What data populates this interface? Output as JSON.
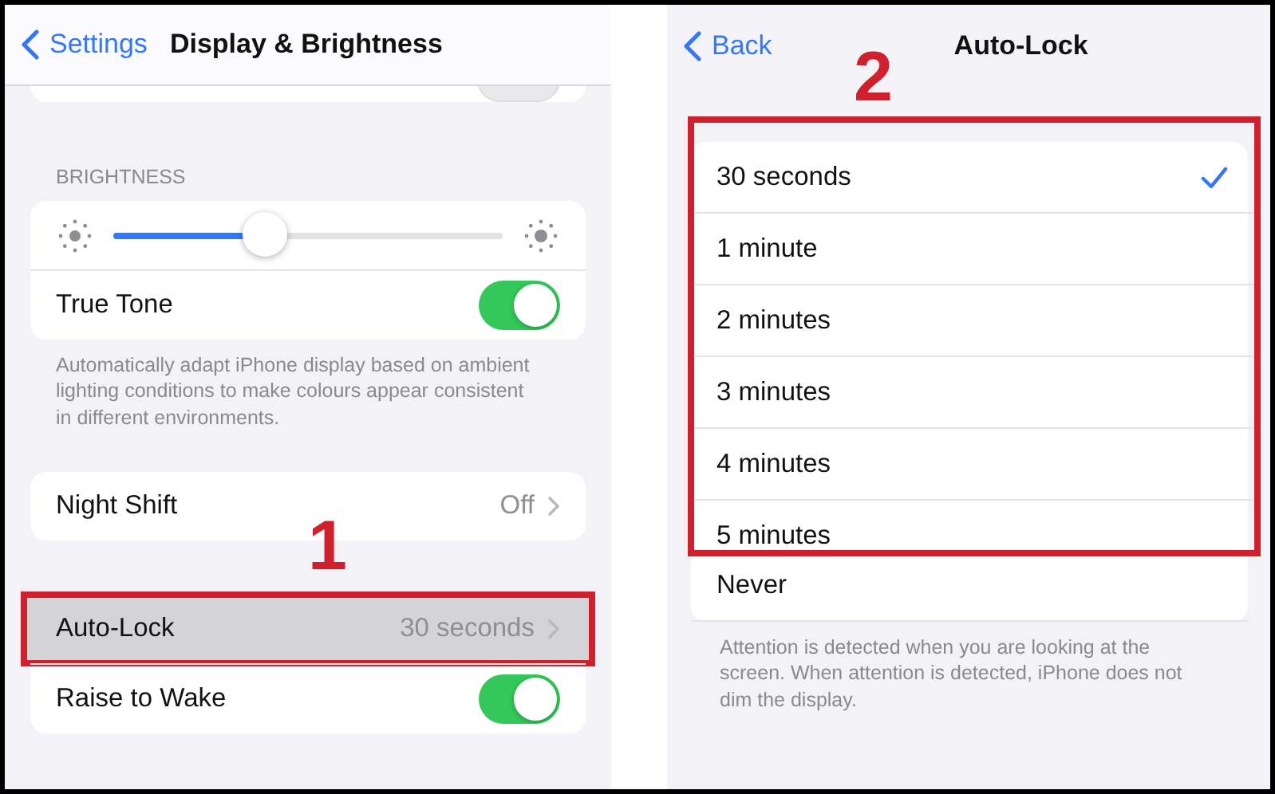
{
  "left_screen": {
    "nav": {
      "back": "Settings",
      "title": "Display & Brightness"
    },
    "groups": [
      {
        "header": "BRIGHTNESS",
        "items": [
          {
            "kind": "slider",
            "level": 0.39
          },
          {
            "kind": "toggle",
            "label": "True Tone",
            "on": true
          }
        ],
        "footer": "Automatically adapt iPhone display based on ambient lighting conditions to make colours appear consistent in different environments."
      },
      {
        "items": [
          {
            "kind": "value",
            "label": "Night Shift",
            "value": "Off",
            "highlighted": false
          }
        ]
      },
      {
        "items": [
          {
            "kind": "value",
            "label": "Auto-Lock",
            "value": "30 seconds",
            "highlighted": true
          },
          {
            "kind": "toggle",
            "label": "Raise to Wake",
            "on": true
          }
        ]
      }
    ],
    "marker": "1"
  },
  "right_screen": {
    "nav": {
      "back": "Back",
      "title": "Auto-Lock"
    },
    "marker": "2",
    "annotated_options": [
      {
        "label": "30 seconds",
        "selected": true
      },
      {
        "label": "1 minute",
        "selected": false
      },
      {
        "label": "2 minutes",
        "selected": false
      },
      {
        "label": "3 minutes",
        "selected": false
      },
      {
        "label": "4 minutes",
        "selected": false
      },
      {
        "label": "5 minutes",
        "selected": false
      }
    ],
    "other_options": [
      {
        "label": "Never",
        "selected": false
      }
    ],
    "footer": "Attention is detected when you are looking at the screen. When attention is detected, iPhone does not dim the display."
  }
}
